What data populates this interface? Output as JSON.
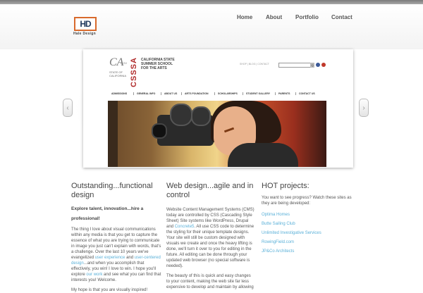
{
  "brand": {
    "logo_mark": "HD",
    "logo_text": "Hale Design"
  },
  "nav": {
    "items": [
      {
        "label": "Home"
      },
      {
        "label": "About"
      },
      {
        "label": "Portfolio"
      },
      {
        "label": "Contact"
      }
    ]
  },
  "slider": {
    "prev_label": "‹",
    "next_label": "›",
    "slide": {
      "ca_logo": "CA",
      "ca_gov": ".GOV",
      "state_label": "STATE OF CALIFORNIA",
      "cssa_abbr": "CSSSA",
      "cssa_full": "CALIFORNIA STATE SUMMER SCHOOL FOR THE ARTS",
      "top_links": "SHOP   |   BLOG   |   CONTACT",
      "search_button": "Q",
      "nav": [
        "ADMISSIONS",
        "GENERAL INFO",
        "ABOUT US",
        "ARTS FOUNDATION",
        "SCHOLARSHIPS",
        "STUDENT GALLERY",
        "PARENTS",
        "CONTACT US"
      ]
    }
  },
  "columns": {
    "col1": {
      "title": "Outstanding...functional design",
      "tagline": "Explore talent, innovation...hire a professional!",
      "p1_a": "The thing I love about visual communications within any media is that you get to capture the essence of what you are trying to communicate in image you just can't explain with words, that's a challenge. Over the last 10 years we've evangelized ",
      "link1": "user experience",
      "p1_b": " and ",
      "link2": "user-centered design",
      "p1_c": "...and when you accomplish that effectively, you win! I love to win. I hope you'll explore ",
      "link3": "our work",
      "p1_d": " and see what you can find that interests you! Welcome.",
      "p2": "My hope is that you are visually inspired!"
    },
    "col2": {
      "title": "Web design...agile and in control",
      "p1_a": "Website Content Management Systems (CMS) today are controlled by CSS (Cascading Style Sheet) Site systems like WordPress, Drupal and ",
      "link1": "Concrete5",
      "p1_b": ". All use CSS code to determine the styling for their unique template designs. Your site will still be custom designed with visuals we create and once the heavy lifting is done, we'll turn it over to you for editing in the future. All editing can be done through your updated web browser (no special software is needed).",
      "p2": "The beauty of this is quick and easy changes to your content, making the web site far less expensive to develop and maintain by allowing"
    },
    "col3": {
      "title": "HOT projects:",
      "intro": "You want to see progress? Watch these sites as they are being developed:",
      "projects": [
        "Optima Homes",
        "Butte Sailing Club",
        "Unlimited Investigative Services",
        "RowingField.com",
        "JP&Co Architects"
      ]
    }
  },
  "colors": {
    "accent": "#d86a2c",
    "link": "#5ab0d8",
    "cssa_red": "#b02a2a"
  }
}
